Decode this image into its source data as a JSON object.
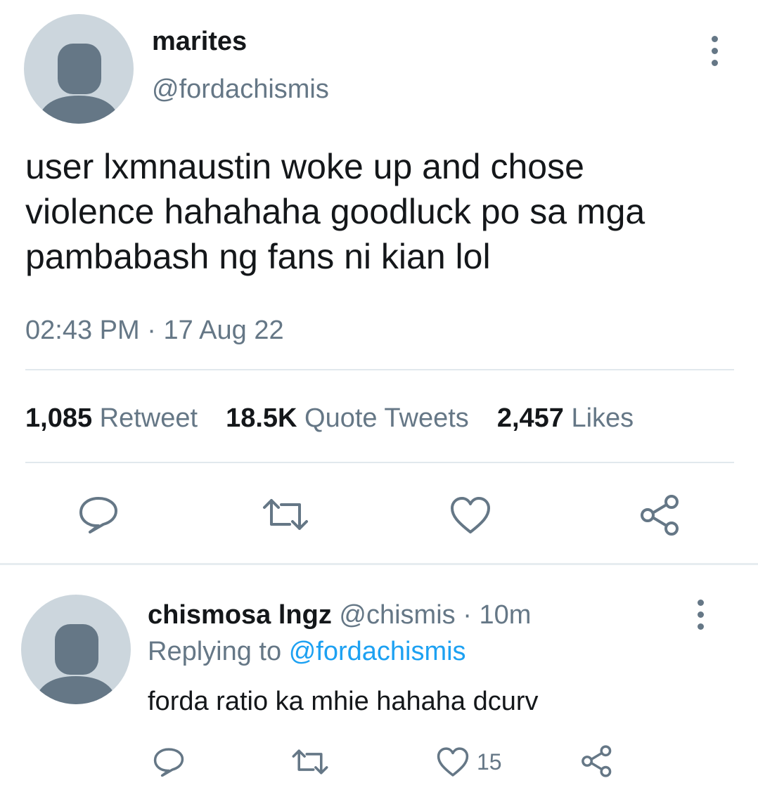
{
  "tweet": {
    "author": {
      "name": "marites",
      "handle": "@fordachismis"
    },
    "text_lines": [
      "user lxmnaustin woke up and chose",
      "violence hahahaha goodluck po sa mga",
      "pambabash ng fans ni kian lol"
    ],
    "time": "02:43 PM",
    "separator": "·",
    "date": "17 Aug 22",
    "stats": {
      "retweets": {
        "count": "1,085",
        "label": "Retweet"
      },
      "quotes": {
        "count": "18.5K",
        "label": "Quote Tweets"
      },
      "likes": {
        "count": "2,457",
        "label": "Likes"
      }
    }
  },
  "reply": {
    "author": {
      "name": "chismosa lngz",
      "handle": "@chismis",
      "separator": "·",
      "time": "10m"
    },
    "replying_label": "Replying to",
    "replying_handle": "@fordachismis",
    "text": "forda ratio ka mhie hahaha dcurv",
    "like_count": "15"
  },
  "icons": {
    "reply": "speech-bubble-icon",
    "retweet": "retweet-arrows-icon",
    "like": "heart-icon",
    "share": "share-nodes-icon",
    "more": "vertical-dots-icon"
  },
  "colors": {
    "text": "#14171a",
    "muted": "#657786",
    "link": "#1da1f2",
    "divider": "#e1e8ed",
    "avatar_bg": "#ccd6dd",
    "avatar_fg": "#657786"
  }
}
